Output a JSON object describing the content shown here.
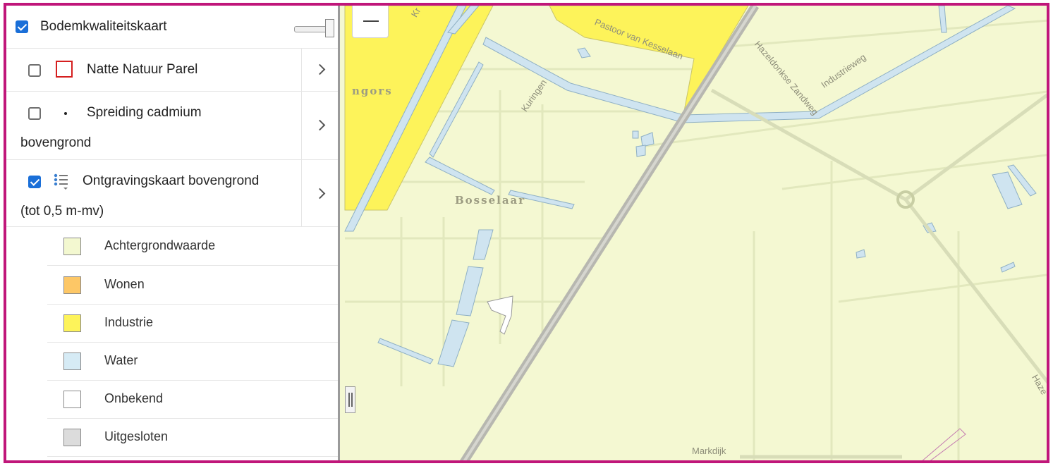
{
  "panel": {
    "main_layer": {
      "label": "Bodemkwaliteitskaart",
      "checked": true
    },
    "layers": [
      {
        "label": "Natte Natuur Parel",
        "checked": false,
        "icon": "red-outline-square-icon"
      },
      {
        "label": "Spreiding cadmium",
        "label_line2": "bovengrond",
        "checked": false,
        "icon": "dot-icon"
      },
      {
        "label": "Ontgravingskaart bovengrond",
        "label_line2": "(tot 0,5 m-mv)",
        "checked": true,
        "icon": "legend-list-icon"
      }
    ],
    "legend": [
      {
        "label": "Achtergrondwaarde",
        "color": "#f3f8d0"
      },
      {
        "label": "Wonen",
        "color": "#fdc766"
      },
      {
        "label": "Industrie",
        "color": "#fdf35a"
      },
      {
        "label": "Water",
        "color": "#d6ebf5"
      },
      {
        "label": "Onbekend",
        "color": "#ffffff"
      },
      {
        "label": "Uitgesloten",
        "color": "#dcdcdc"
      }
    ]
  },
  "map": {
    "labels": {
      "bosselaar": "Bosselaar",
      "tangors": "ngors",
      "kuringen": "Kuringen",
      "hazeldonkse": "Hazeldonkse Zandweg",
      "industrieweg": "Industrieweg",
      "pastoor": "Pastoor van Kesselaan",
      "markdijk": "Markdijk",
      "haze": "Haze",
      "kr": "Kr"
    },
    "colors": {
      "background": "#f4f8d2",
      "industrie": "#fdf35a",
      "water": "#cfe4f0",
      "rail": "#b7b7b0",
      "frame": "#c0167a"
    }
  }
}
